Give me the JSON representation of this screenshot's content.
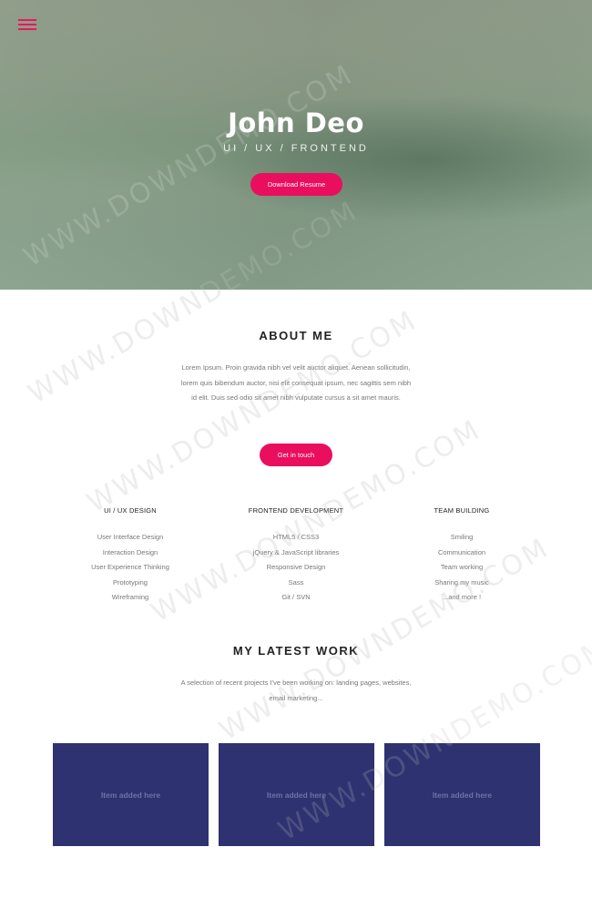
{
  "hero": {
    "name": "John Deo",
    "subtitle": "UI / UX / FRONTEND",
    "resume_button": "Download Resume",
    "menu_icon": "hamburger-menu-icon"
  },
  "about": {
    "title": "ABOUT ME",
    "paragraph_lines": [
      "Lorem Ipsum. Proin gravida nibh vel velit auctor aliquet. Aenean sollicitudin,",
      "lorem quis bibendum auctor, nisi elit consequat ipsum, nec sagittis sem nibh",
      "id elit. Duis sed odio sit amet nibh vulputate cursus a sit amet mauris."
    ],
    "contact_button": "Get in touch"
  },
  "skills": [
    {
      "heading": "UI / UX DESIGN",
      "items": [
        "User Interface Design",
        "Interaction Design",
        "User Experience Thinking",
        "Prototyping",
        "Wireframing"
      ]
    },
    {
      "heading": "FRONTEND DEVELOPMENT",
      "items": [
        "HTML5 / CSS3",
        "jQuery & JavaScript libraries",
        "Responsive Design",
        "Sass",
        "Git / SVN"
      ]
    },
    {
      "heading": "TEAM BUILDING",
      "items": [
        "Smiling",
        "Communication",
        "Team working",
        "Sharing my music",
        "...and more !"
      ]
    }
  ],
  "work": {
    "title": "MY LATEST WORK",
    "paragraph_lines": [
      "A selection of recent projects I've been working on: landing pages, websites,",
      "email marketing..."
    ],
    "cards": [
      "Item added here",
      "Item added here",
      "Item added here"
    ]
  },
  "watermark": "WWW.DOWNDEMO.COM",
  "colors": {
    "accent": "#ea0e5e",
    "card_bg": "#2e3270",
    "hero_green": "#829c84"
  }
}
